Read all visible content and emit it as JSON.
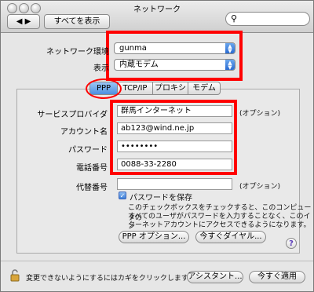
{
  "window": {
    "title": "ネットワーク"
  },
  "toolbar": {
    "nav_label": "◀ ▶",
    "show_all": "すべてを表示",
    "search_icon": "magnifier-icon"
  },
  "top": {
    "location_label": "ネットワーク環境",
    "location_value": "gunma",
    "show_label": "表示",
    "show_value": "内蔵モデム"
  },
  "tabs": [
    "PPP",
    "TCP/IP",
    "プロキシ",
    "モデム"
  ],
  "form": {
    "provider_label": "サービスプロバイダ",
    "provider_value": "群馬インターネット",
    "account_label": "アカウント名",
    "account_value": "ab123@wind.ne.jp",
    "password_label": "パスワード",
    "password_value": "••••••••",
    "phone_label": "電話番号",
    "phone_value": "0088-33-2280",
    "alt_phone_label": "代替番号",
    "alt_phone_value": "",
    "optional": "(オプション)",
    "save_password_label": "パスワードを保存",
    "note_lines": [
      "このチェックボックスをチェックすると、このコンピュータの",
      "すべてのユーザがパスワードを入力することなく、このイン",
      "ターネットアカウントにアクセスできるようになります。"
    ]
  },
  "buttons": {
    "ppp_options": "PPP オプション...",
    "dial_now": "今すぐダイヤル...",
    "help": "?",
    "assistant": "アシスタント...",
    "apply_now": "今すぐ適用"
  },
  "footer": {
    "lock_text": "変更できないようにするにはカギをクリックします。"
  }
}
